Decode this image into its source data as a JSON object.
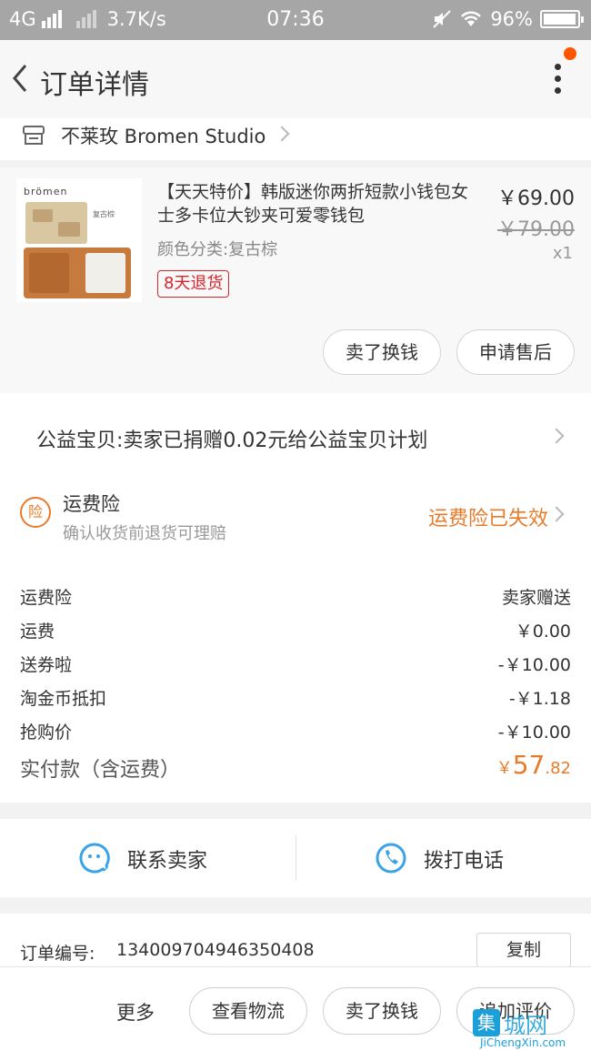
{
  "status_bar": {
    "network": "4G",
    "speed": "3.7K/s",
    "time": "07:36",
    "battery": "96%",
    "battery_level": 0.96
  },
  "nav": {
    "title": "订单详情",
    "icons": {
      "back": "chevron-left-icon",
      "more": "more-vertical-icon"
    },
    "notification_dot_color": "#ff5500"
  },
  "shop": {
    "name": "不莱玫 Bromen Studio",
    "icon": "store-icon"
  },
  "product": {
    "thumb_brand": "brömen",
    "thumb_label": "复古棕",
    "title": "【天天特价】韩版迷你两折短款小钱包女士多卡位大钞夹可爱零钱包",
    "variant": "颜色分类:复古棕",
    "tag": "8天退货",
    "price": "￥69.00",
    "original_price": "￥79.00",
    "quantity": "x1",
    "buttons": {
      "sell": "卖了换钱",
      "after_sale": "申请售后"
    }
  },
  "charity": {
    "text": "公益宝贝:卖家已捐赠0.02元给公益宝贝计划"
  },
  "insurance": {
    "icon_char": "险",
    "title": "运费险",
    "subtitle": "确认收货前退货可理赔",
    "status": "运费险已失效",
    "accent": "#e87b2a"
  },
  "fees": [
    {
      "label": "运费险",
      "value": "卖家赠送"
    },
    {
      "label": "运费",
      "value": "￥0.00"
    },
    {
      "label": "送券啦",
      "value": "-￥10.00"
    },
    {
      "label": "淘金币抵扣",
      "value": "-￥1.18"
    },
    {
      "label": "抢购价",
      "value": "-￥10.00"
    }
  ],
  "total": {
    "label": "实付款（含运费）",
    "currency": "￥",
    "integer": "57",
    "decimal": ".82"
  },
  "contact": {
    "seller": {
      "label": "联系卖家",
      "icon": "chat-icon"
    },
    "phone": {
      "label": "拨打电话",
      "icon": "phone-icon"
    },
    "accent": "#3aa4e6"
  },
  "order": {
    "label": "订单编号:",
    "number": "134009704946350408",
    "copy": "复制"
  },
  "bottom": {
    "more": "更多",
    "logistics": "查看物流",
    "sell": "卖了换钱",
    "review": "追加评价"
  },
  "watermark": {
    "mark": "集",
    "cn": "城网",
    "en": "JiChengXin.com"
  }
}
